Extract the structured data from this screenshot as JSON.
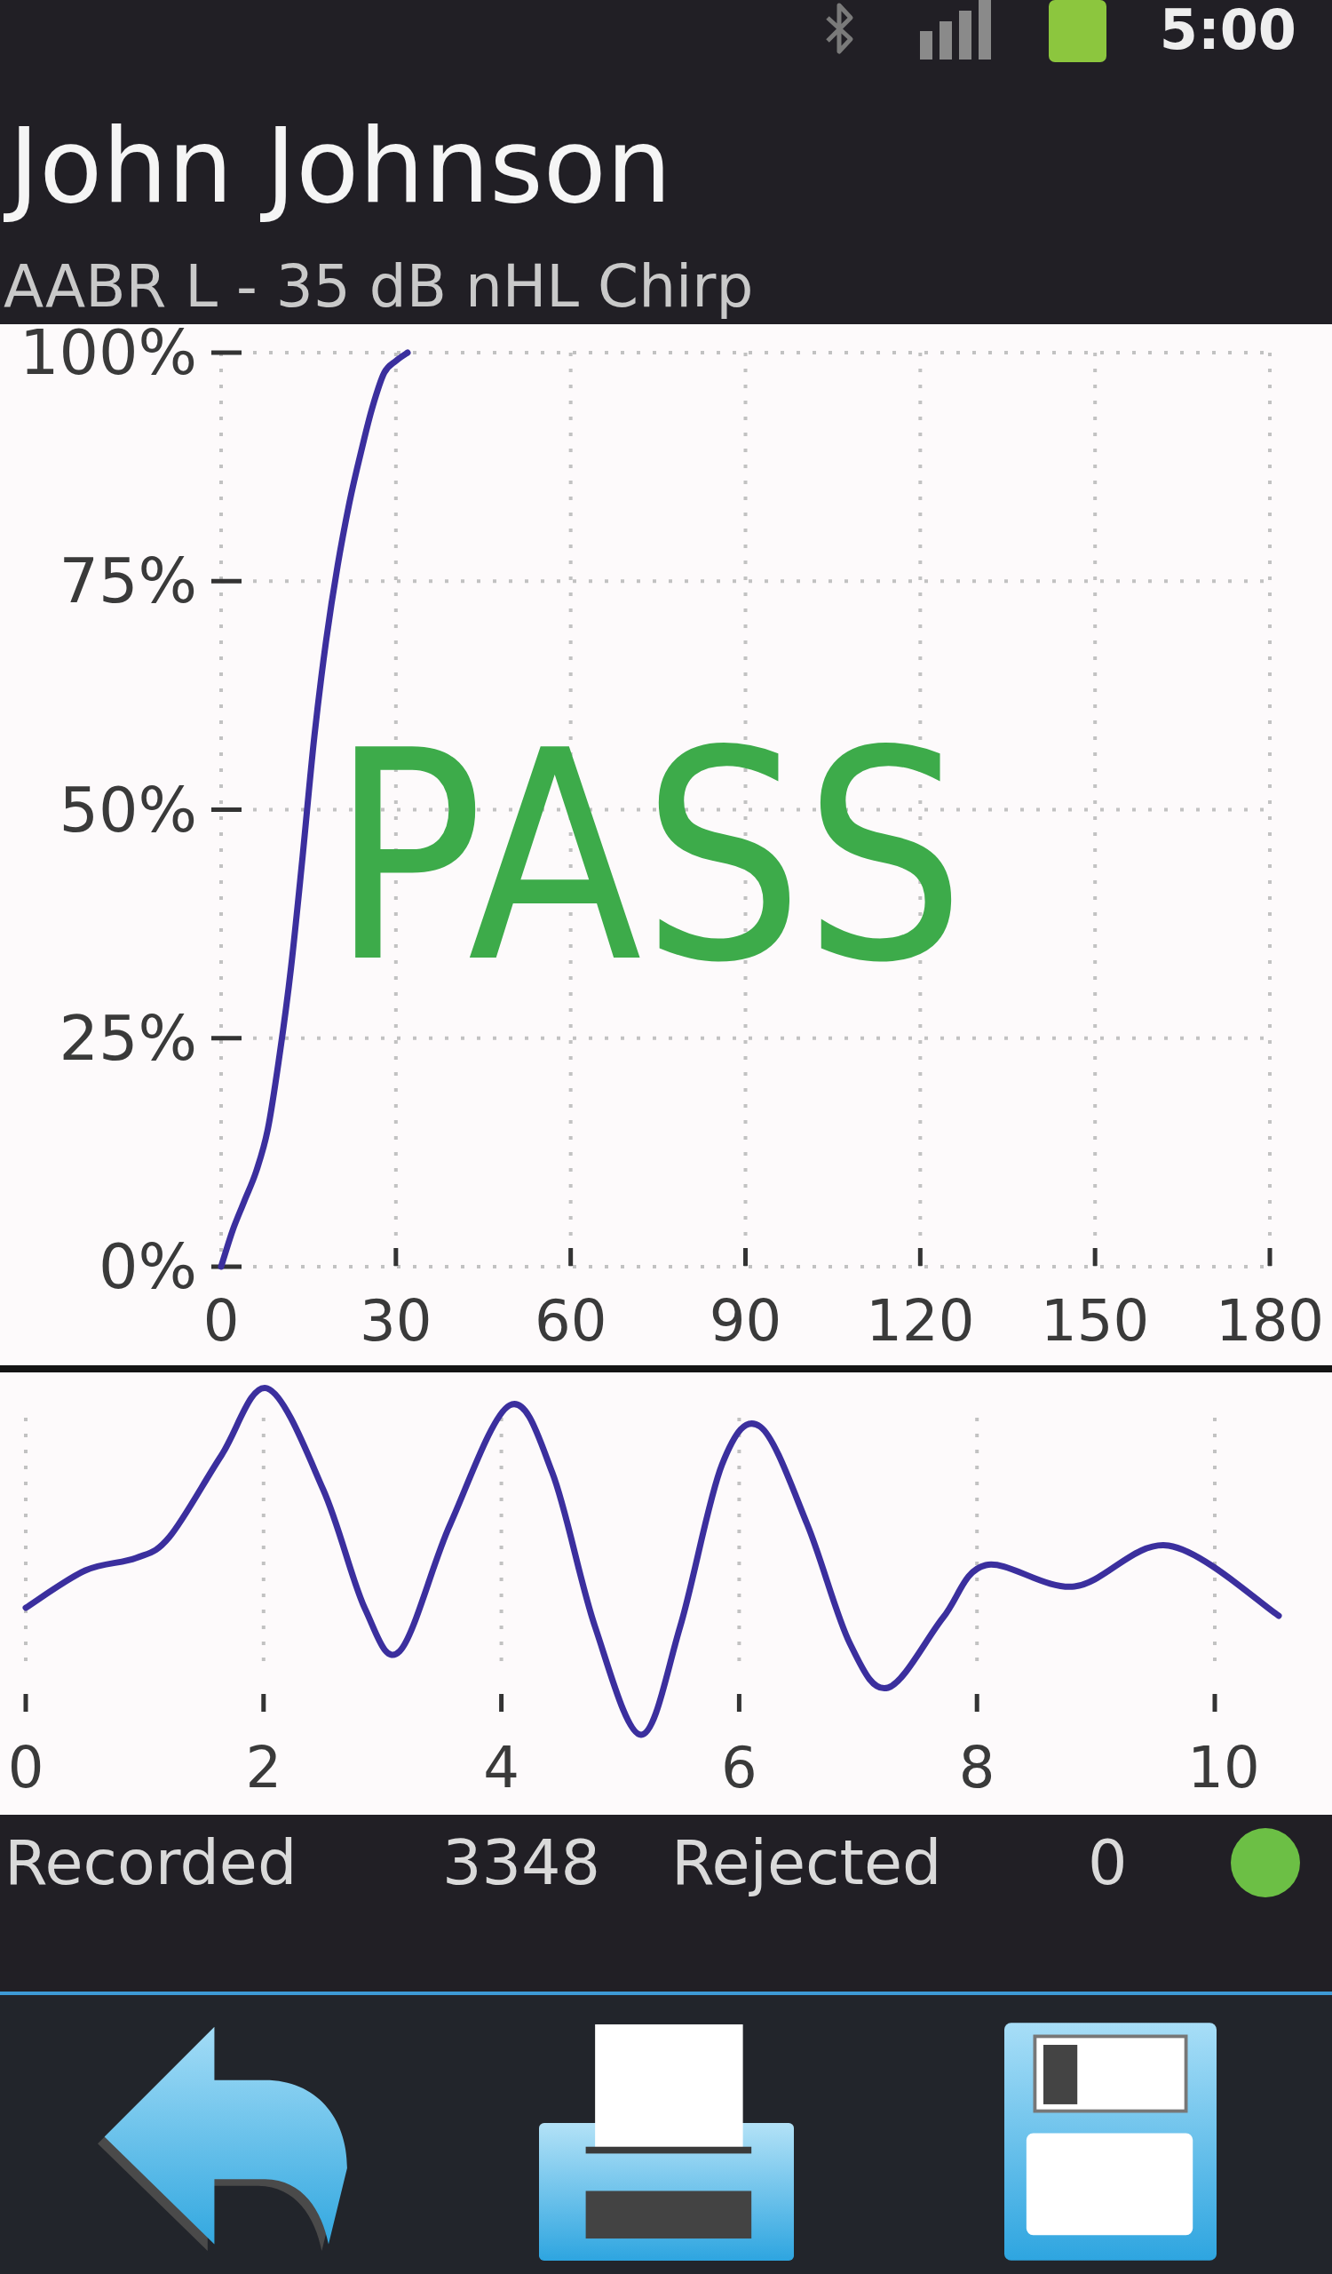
{
  "status_bar": {
    "time": "5:00"
  },
  "header": {
    "title": "John Johnson",
    "subtitle": "AABR L - 35 dB nHL Chirp"
  },
  "response_chart": {
    "result": "PASS",
    "chart_data": {
      "type": "line",
      "x": [
        0,
        2,
        4,
        6,
        8,
        10,
        12,
        14,
        16,
        18,
        20,
        22,
        24,
        26,
        28,
        30,
        32
      ],
      "series": [
        {
          "color": "#3b2f9e",
          "values": [
            0,
            4,
            7.2,
            10.4,
            15,
            23,
            32.7,
            45,
            58,
            68.4,
            76.7,
            83.5,
            89.1,
            94.1,
            97.8,
            99.1,
            100
          ]
        }
      ],
      "xlim": [
        0,
        180
      ],
      "ylim": [
        0,
        100
      ],
      "xticks": [
        0,
        30,
        60,
        90,
        120,
        150,
        180
      ],
      "yticks": [
        {
          "value": 0,
          "label": "0%"
        },
        {
          "value": 25,
          "label": "25%"
        },
        {
          "value": 50,
          "label": "50%"
        },
        {
          "value": 75,
          "label": "75%"
        },
        {
          "value": 100,
          "label": "100%"
        }
      ],
      "grid": true
    }
  },
  "waveform": {
    "x_labels": [
      "0",
      "2",
      "4",
      "6",
      "8",
      "10"
    ]
  },
  "stats": {
    "counters": [
      {
        "label": "Recorded",
        "value": "3348"
      },
      {
        "label": "Rejected",
        "value": "0"
      }
    ],
    "indicator": {
      "color": "#6cbf45"
    }
  }
}
